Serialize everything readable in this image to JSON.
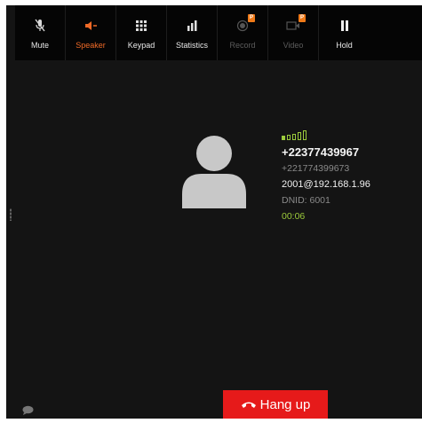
{
  "toolbar": {
    "buttons": [
      {
        "label": "Mute",
        "icon": "mic-muted-icon",
        "state": "normal"
      },
      {
        "label": "Speaker",
        "icon": "speaker-icon",
        "state": "active"
      },
      {
        "label": "Keypad",
        "icon": "keypad-icon",
        "state": "normal"
      },
      {
        "label": "Statistics",
        "icon": "bar-chart-icon",
        "state": "normal"
      },
      {
        "label": "Record",
        "icon": "record-icon",
        "state": "disabled",
        "badge": "P"
      },
      {
        "label": "Video",
        "icon": "video-camera-icon",
        "state": "disabled",
        "badge": "P"
      },
      {
        "label": "Hold",
        "icon": "pause-icon",
        "state": "normal"
      }
    ]
  },
  "call": {
    "signal_bars_active": 1,
    "signal_bars_total": 5,
    "primary_number": "+22377439967",
    "secondary_number": "+221774399673",
    "account": "2001@192.168.1.96",
    "dnid": "DNID: 6001",
    "duration": "00:06"
  },
  "hangup": {
    "label": "Hang up"
  },
  "colors": {
    "accent_orange": "#f06a27",
    "signal_green": "#9ccb3b",
    "hangup_red": "#e61a1a",
    "background": "#141414"
  }
}
